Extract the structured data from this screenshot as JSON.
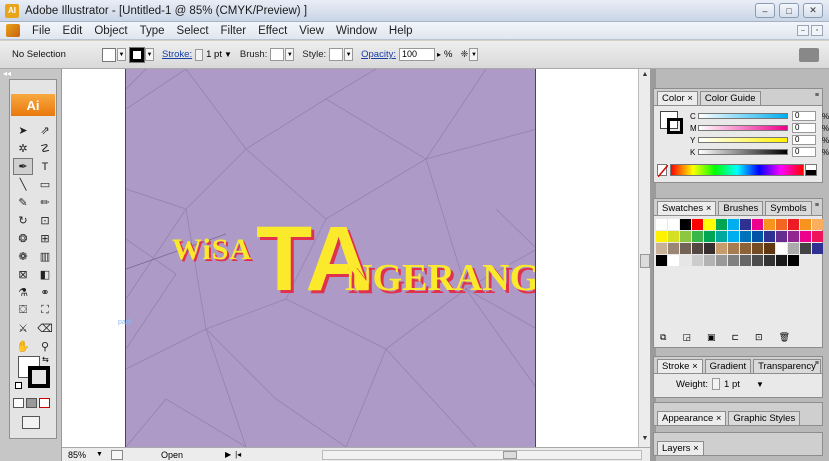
{
  "window": {
    "title": "Adobe Illustrator - [Untitled-1 @ 85% (CMYK/Preview) ]",
    "app_badge": "AI",
    "controls": [
      "–",
      "□",
      "✕"
    ]
  },
  "menubar": {
    "items": [
      "File",
      "Edit",
      "Object",
      "Type",
      "Select",
      "Filter",
      "Effect",
      "View",
      "Window",
      "Help"
    ]
  },
  "controlbar": {
    "selection_label": "No Selection",
    "stroke_label": "Stroke:",
    "stroke_value": "1 pt",
    "brush_label": "Brush:",
    "style_label": "Style:",
    "opacity_label": "Opacity:",
    "opacity_value": "100",
    "opacity_unit": "%"
  },
  "toolbox": {
    "logo": "Ai",
    "collapse": "◂◂",
    "tools": [
      {
        "name": "selection-tool-icon",
        "glyph": "➤"
      },
      {
        "name": "direct-selection-tool-icon",
        "glyph": "⇗"
      },
      {
        "name": "magic-wand-tool-icon",
        "glyph": "✲"
      },
      {
        "name": "lasso-tool-icon",
        "glyph": "☡"
      },
      {
        "name": "pen-tool-icon",
        "glyph": "✒"
      },
      {
        "name": "type-tool-icon",
        "glyph": "T"
      },
      {
        "name": "line-tool-icon",
        "glyph": "╲"
      },
      {
        "name": "rectangle-tool-icon",
        "glyph": "▭"
      },
      {
        "name": "paintbrush-tool-icon",
        "glyph": "✎"
      },
      {
        "name": "pencil-tool-icon",
        "glyph": "✏"
      },
      {
        "name": "rotate-tool-icon",
        "glyph": "↻"
      },
      {
        "name": "scale-tool-icon",
        "glyph": "⊡"
      },
      {
        "name": "warp-tool-icon",
        "glyph": "❂"
      },
      {
        "name": "free-transform-tool-icon",
        "glyph": "⊞"
      },
      {
        "name": "symbol-sprayer-tool-icon",
        "glyph": "❁"
      },
      {
        "name": "column-graph-tool-icon",
        "glyph": "▥"
      },
      {
        "name": "mesh-tool-icon",
        "glyph": "⊠"
      },
      {
        "name": "gradient-tool-icon",
        "glyph": "◧"
      },
      {
        "name": "eyedropper-tool-icon",
        "glyph": "⚗"
      },
      {
        "name": "blend-tool-icon",
        "glyph": "⚭"
      },
      {
        "name": "live-paint-tool-icon",
        "glyph": "⛋"
      },
      {
        "name": "live-paint-selection-tool-icon",
        "glyph": "⛶"
      },
      {
        "name": "slice-tool-icon",
        "glyph": "⚔"
      },
      {
        "name": "eraser-tool-icon",
        "glyph": "⌫"
      },
      {
        "name": "hand-tool-icon",
        "glyph": "✋"
      },
      {
        "name": "zoom-tool-icon",
        "glyph": "⚲"
      }
    ]
  },
  "artwork": {
    "word_left": "WiSA",
    "word_big": "TA",
    "word_right": "NGERANG",
    "path_label": "path",
    "fill_color": "#fbe92b",
    "shadow_color": "#e0314e",
    "bg_color": "#ad9ac6"
  },
  "statusbar": {
    "zoom": "85%",
    "status": "Open"
  },
  "panels": {
    "color": {
      "tabs": [
        "Color ×",
        "Color Guide"
      ],
      "rows": [
        {
          "letter": "C",
          "value": "0",
          "unit": "%"
        },
        {
          "letter": "M",
          "value": "0",
          "unit": "%"
        },
        {
          "letter": "Y",
          "value": "0",
          "unit": "%"
        },
        {
          "letter": "K",
          "value": "0",
          "unit": "%"
        }
      ]
    },
    "swatches": {
      "tabs": [
        "Swatches ×",
        "Brushes",
        "Symbols"
      ],
      "colors": [
        "#ffffff",
        "#ffffff",
        "#000000",
        "#ff0000",
        "#ffff00",
        "#00a651",
        "#00aeef",
        "#2e3192",
        "#ec008c",
        "#f7941d",
        "#f26522",
        "#ed1c24",
        "#f7941d",
        "#fbaf5d",
        "#fff200",
        "#d7df23",
        "#8dc63f",
        "#39b54a",
        "#00a651",
        "#00a99d",
        "#00aeef",
        "#0072bc",
        "#0054a6",
        "#2e3192",
        "#662d91",
        "#92278f",
        "#ec008c",
        "#ed145b",
        "#c7b299",
        "#998675",
        "#736357",
        "#534741",
        "#362f2d",
        "#c69c6d",
        "#a67c52",
        "#8c6239",
        "#754c24",
        "#603913",
        "#ffffff",
        "#aaaaaa",
        "#444444",
        "#2e3192",
        "#000000",
        "#ffffff",
        "#e6e6e6",
        "#cccccc",
        "#b3b3b3",
        "#999999",
        "#808080",
        "#666666",
        "#4d4d4d",
        "#333333",
        "#1a1a1a",
        "#000000"
      ]
    },
    "stroke": {
      "tabs": [
        "Stroke ×",
        "Gradient",
        "Transparency"
      ],
      "weight_label": "Weight:",
      "weight_value": "1 pt"
    },
    "appearance": {
      "tabs": [
        "Appearance ×",
        "Graphic Styles"
      ]
    },
    "layers": {
      "tabs": [
        "Layers ×"
      ]
    }
  }
}
